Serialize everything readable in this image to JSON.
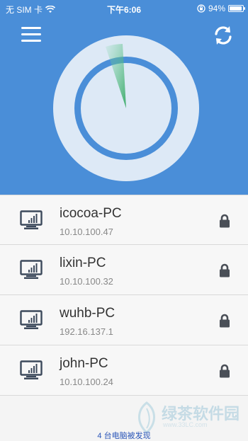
{
  "status_bar": {
    "carrier": "无 SIM 卡",
    "time": "下午6:06",
    "battery_text": "94%",
    "battery_level": 0.94
  },
  "toolbar": {
    "menu_icon": "hamburger-menu-icon",
    "refresh_icon": "refresh-icon"
  },
  "devices": [
    {
      "name": "icocoa-PC",
      "ip": "10.10.100.47"
    },
    {
      "name": "lixin-PC",
      "ip": "10.10.100.32"
    },
    {
      "name": "wuhb-PC",
      "ip": "192.16.137.1"
    },
    {
      "name": "john-PC",
      "ip": "10.10.100.24"
    }
  ],
  "footer": {
    "discovered_text": "4 台电脑被发现"
  },
  "watermark": {
    "title": "绿茶软件园",
    "url": "www.33LC.com"
  },
  "colors": {
    "header_bg": "#4a8ed8",
    "radar_ring": "#dde9f6",
    "radar_inner": "#4a8ed8",
    "radar_sweep": "#48b07a"
  }
}
